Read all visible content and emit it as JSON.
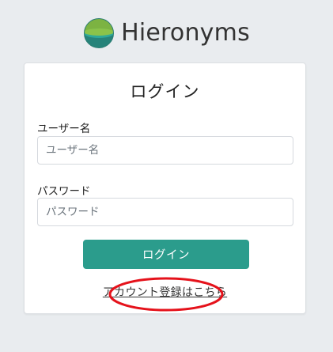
{
  "brand": {
    "name": "Hieronyms",
    "logo_icon": "hieronyms-logo-icon",
    "logo_colors": {
      "top": "#7cb342",
      "bottom": "#26837a",
      "band": "#2b9c8c"
    }
  },
  "login_card": {
    "title": "ログイン",
    "username": {
      "label": "ユーザー名",
      "placeholder": "ユーザー名",
      "value": ""
    },
    "password": {
      "label": "パスワード",
      "placeholder": "パスワード",
      "value": ""
    },
    "submit_label": "ログイン",
    "register_link": "アカウント登録はこちら"
  },
  "colors": {
    "accent": "#2b9c8c",
    "background": "#e9ecef",
    "annotation": "#e5121b"
  }
}
